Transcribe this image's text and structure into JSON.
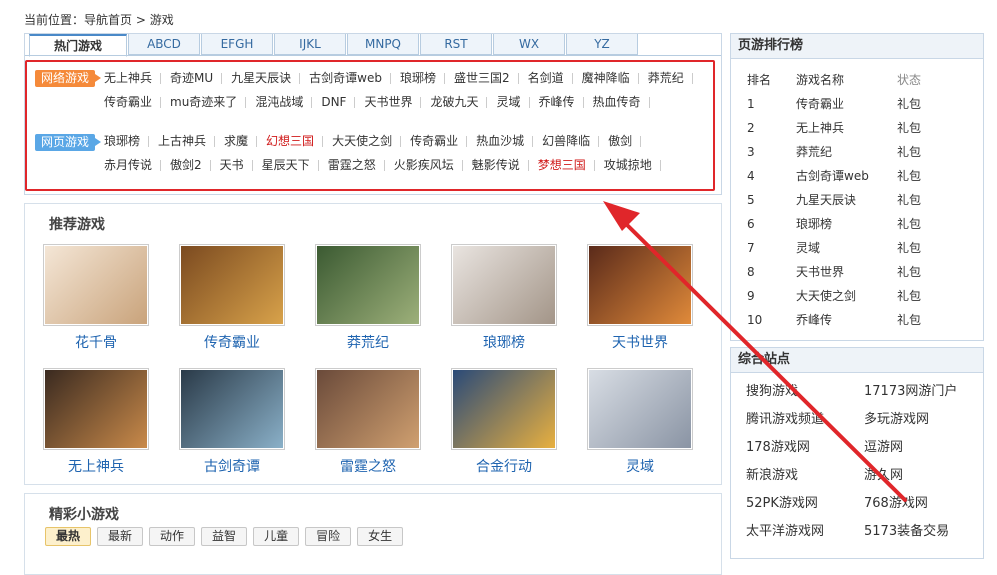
{
  "breadcrumb": {
    "prefix": "当前位置：",
    "home": "导航首页",
    "sep": " > ",
    "current": "游戏"
  },
  "tabs": [
    "热门游戏",
    "ABCD",
    "EFGH",
    "IJKL",
    "MNPQ",
    "RST",
    "WX",
    "YZ"
  ],
  "online_games": {
    "badge": "网络游戏",
    "row1": [
      "无上神兵",
      "奇迹MU",
      "九星天辰诀",
      "古剑奇谭web",
      "琅琊榜",
      "盛世三国2",
      "名剑道",
      "魔神降临",
      "莽荒纪"
    ],
    "row2": [
      "传奇霸业",
      "mu奇迹来了",
      "混沌战域",
      "DNF",
      "天书世界",
      "龙破九天",
      "灵域",
      "乔峰传",
      "热血传奇"
    ]
  },
  "web_games": {
    "badge": "网页游戏",
    "row1": [
      "琅琊榜",
      "上古神兵",
      "求魔",
      "幻想三国",
      "大天使之剑",
      "传奇霸业",
      "热血沙城",
      "幻兽降临",
      "傲剑"
    ],
    "row1_red": [
      "幻想三国"
    ],
    "row2": [
      "赤月传说",
      "傲剑2",
      "天书",
      "星辰天下",
      "雷霆之怒",
      "火影疾风坛",
      "魅影传说",
      "梦想三国",
      "攻城掠地"
    ],
    "row2_red": [
      "梦想三国"
    ]
  },
  "recommended": {
    "title": "推荐游戏",
    "games": [
      "花千骨",
      "传奇霸业",
      "莽荒纪",
      "琅琊榜",
      "天书世界",
      "无上神兵",
      "古剑奇谭",
      "雷霆之怒",
      "合金行动",
      "灵域"
    ]
  },
  "mini_games": {
    "title": "精彩小游戏",
    "tags": [
      "最热",
      "最新",
      "动作",
      "益智",
      "儿童",
      "冒险",
      "女生"
    ]
  },
  "ranking": {
    "title": "页游排行榜",
    "headers": [
      "排名",
      "游戏名称",
      "状态"
    ],
    "rows": [
      [
        "1",
        "传奇霸业",
        "礼包"
      ],
      [
        "2",
        "无上神兵",
        "礼包"
      ],
      [
        "3",
        "莽荒纪",
        "礼包"
      ],
      [
        "4",
        "古剑奇谭web",
        "礼包"
      ],
      [
        "5",
        "九星天辰诀",
        "礼包"
      ],
      [
        "6",
        "琅琊榜",
        "礼包"
      ],
      [
        "7",
        "灵域",
        "礼包"
      ],
      [
        "8",
        "天书世界",
        "礼包"
      ],
      [
        "9",
        "大天使之剑",
        "礼包"
      ],
      [
        "10",
        "乔峰传",
        "礼包"
      ]
    ]
  },
  "sites": {
    "title": "综合站点",
    "items": [
      "搜狗游戏",
      "17173网游门户",
      "腾讯游戏频道",
      "多玩游戏网",
      "178游戏网",
      "逗游网",
      "新浪游戏",
      "游久网",
      "52PK游戏网",
      "768游戏网",
      "太平洋游戏网",
      "5173装备交易"
    ]
  },
  "colors": {
    "annotation_red": "#e0262a",
    "link_blue": "#1f64b0",
    "orange_badge": "#f58a3a",
    "blue_badge": "#5aa7e6"
  }
}
